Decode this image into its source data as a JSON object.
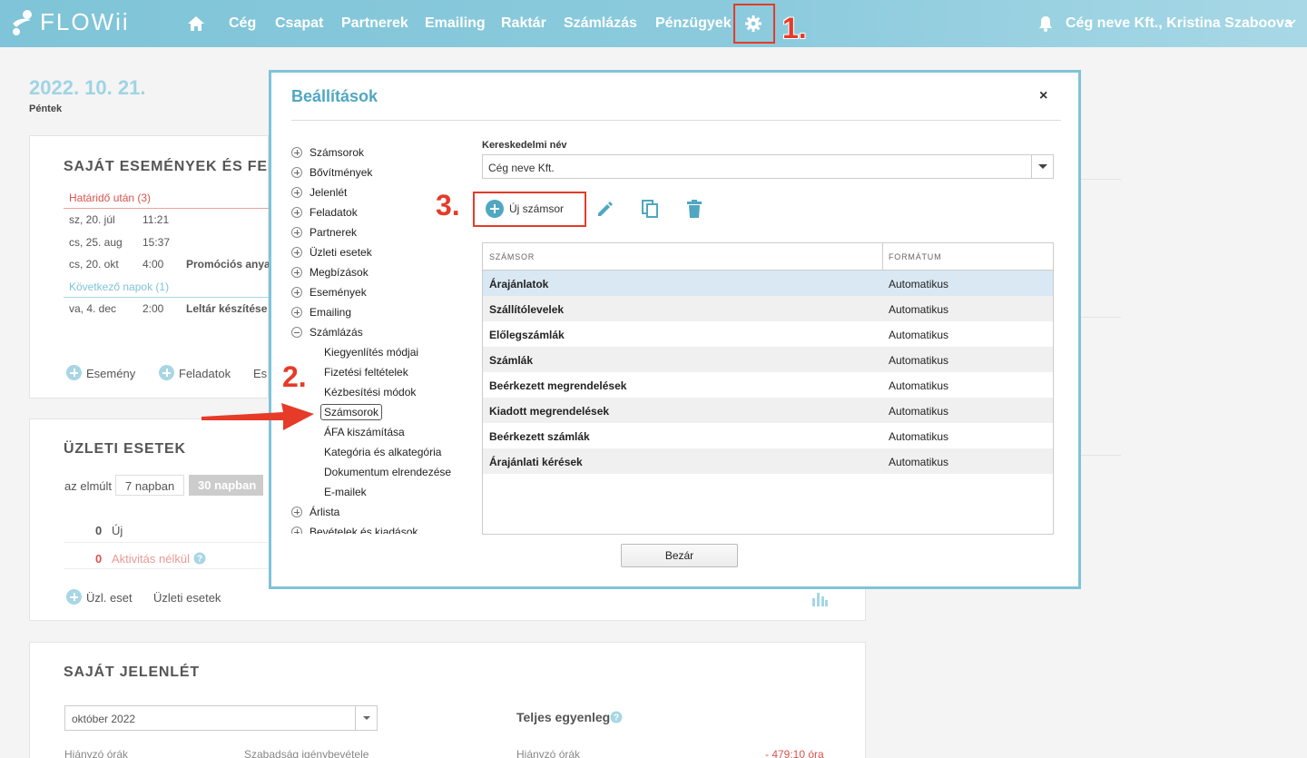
{
  "app": {
    "logo": "FLOWii"
  },
  "nav": {
    "items": [
      "Cég",
      "Csapat",
      "Partnerek",
      "Emailing",
      "Raktár",
      "Számlázás",
      "Pénzügyek"
    ],
    "user": "Cég neve Kft., Kristina Szaboova"
  },
  "steps": {
    "one": "1.",
    "two": "2.",
    "three": "3."
  },
  "dashboard": {
    "date": "2022. 10. 21.",
    "weekday": "Péntek",
    "events_title": "SAJÁT ESEMÉNYEK ÉS FELA",
    "overdue_label": "Határidő után (3)",
    "events": [
      {
        "day": "sz, 20. júl",
        "time": "11:21",
        "title": ""
      },
      {
        "day": "cs, 25. aug",
        "time": "15:37",
        "title": ""
      },
      {
        "day": "cs, 20. okt",
        "time": "4:00",
        "title": "Promóciós anyag"
      }
    ],
    "next_label": "Következő napok (1)",
    "next_events": [
      {
        "day": "va, 4. dec",
        "time": "2:00",
        "title": "Leltár készítése"
      }
    ],
    "events_actions": [
      "Esemény",
      "Feladatok",
      "Es"
    ],
    "deals_title": "ÜZLETI ESETEK",
    "deals_period_prefix": "az elmúlt",
    "deals_periods": [
      "7 napban",
      "30 napban"
    ],
    "deals_stats": [
      {
        "count": "0",
        "label": "Új"
      },
      {
        "count": "0",
        "label": "Aktivitás nélkül"
      }
    ],
    "deals_actions": [
      "Üzl. eset",
      "Üzleti esetek"
    ],
    "attendance_title": "SAJÁT JELENLÉT",
    "attendance_month": "október 2022",
    "attendance_balance": "Teljes egyenleg",
    "attendance_missing": "Hiányzó órák",
    "attendance_leave": "Szabadság igénybevétele",
    "attendance_missing_value": "- 479:10 óra"
  },
  "modal": {
    "title": "Beállítások",
    "close": "×",
    "tree": [
      {
        "label": "Számsorok",
        "expanded": false
      },
      {
        "label": "Bővítmények",
        "expanded": false
      },
      {
        "label": "Jelenlét",
        "expanded": false
      },
      {
        "label": "Feladatok",
        "expanded": false
      },
      {
        "label": "Partnerek",
        "expanded": false
      },
      {
        "label": "Üzleti esetek",
        "expanded": false
      },
      {
        "label": "Megbízások",
        "expanded": false
      },
      {
        "label": "Események",
        "expanded": false
      },
      {
        "label": "Emailing",
        "expanded": false
      },
      {
        "label": "Számlázás",
        "expanded": true
      }
    ],
    "tree_children": [
      "Kiegyenlítés módjai",
      "Fizetési feltételek",
      "Kézbesítési módok",
      "Számsorok",
      "ÁFA kiszámítása",
      "Kategória és alkategória",
      "Dokumentum elrendezése",
      "E-mailek"
    ],
    "tree_after": [
      "Árlista",
      "Bevételek és kiadások"
    ],
    "field_label": "Kereskedelmi név",
    "field_value": "Cég neve Kft.",
    "new_button": "Új számsor",
    "table_headers": [
      "SZÁMSOR",
      "FORMÁTUM"
    ],
    "rows": [
      {
        "name": "Árajánlatok",
        "format": "Automatikus"
      },
      {
        "name": "Szállítólevelek",
        "format": "Automatikus"
      },
      {
        "name": "Előlegszámlák",
        "format": "Automatikus"
      },
      {
        "name": "Számlák",
        "format": "Automatikus"
      },
      {
        "name": "Beérkezett megrendelések",
        "format": "Automatikus"
      },
      {
        "name": "Kiadott megrendelések",
        "format": "Automatikus"
      },
      {
        "name": "Beérkezett számlák",
        "format": "Automatikus"
      },
      {
        "name": "Árajánlati kérések",
        "format": "Automatikus"
      }
    ],
    "close_button": "Bezár"
  },
  "colors": {
    "accent": "#7fc4d8",
    "annotation": "#e53b28",
    "title": "#4fa7c1"
  }
}
